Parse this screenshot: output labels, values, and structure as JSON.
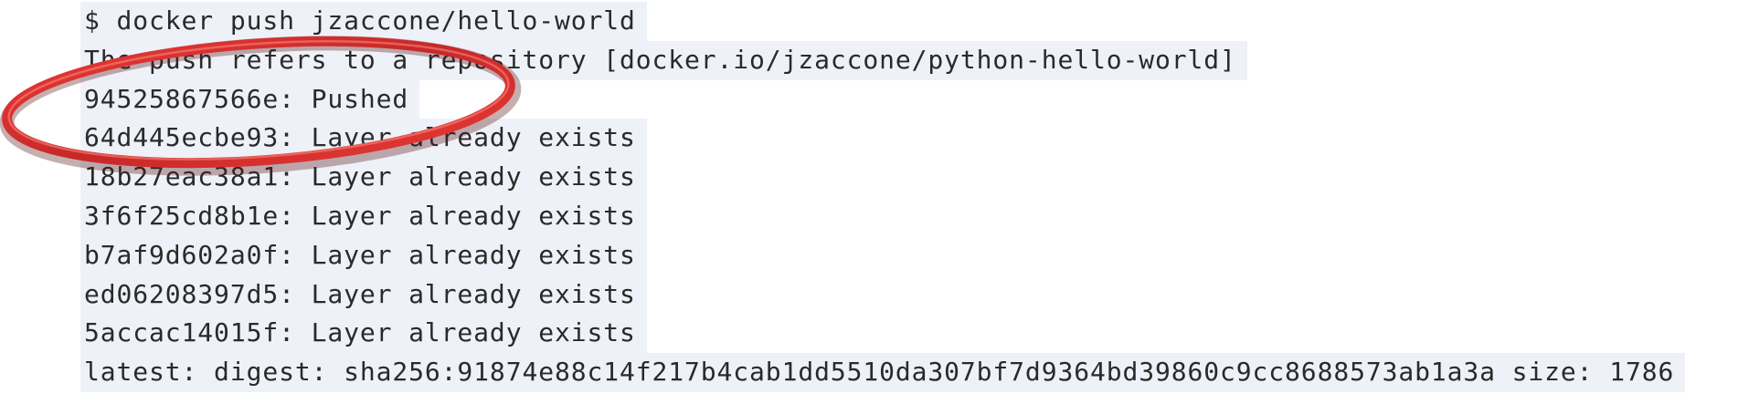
{
  "terminal": {
    "lines": [
      "$ docker push jzaccone/hello-world",
      "The push refers to a repository [docker.io/jzaccone/python-hello-world]",
      "94525867566e: Pushed",
      "64d445ecbe93: Layer already exists",
      "18b27eac38a1: Layer already exists",
      "3f6f25cd8b1e: Layer already exists",
      "b7af9d602a0f: Layer already exists",
      "ed06208397d5: Layer already exists",
      "5accac14015f: Layer already exists",
      "latest: digest: sha256:91874e88c14f217b4cab1dd5510da307bf7d9364bd39860c9cc8688573ab1a3a size: 1786"
    ]
  },
  "annotation": {
    "highlight_color": "#c62828"
  }
}
